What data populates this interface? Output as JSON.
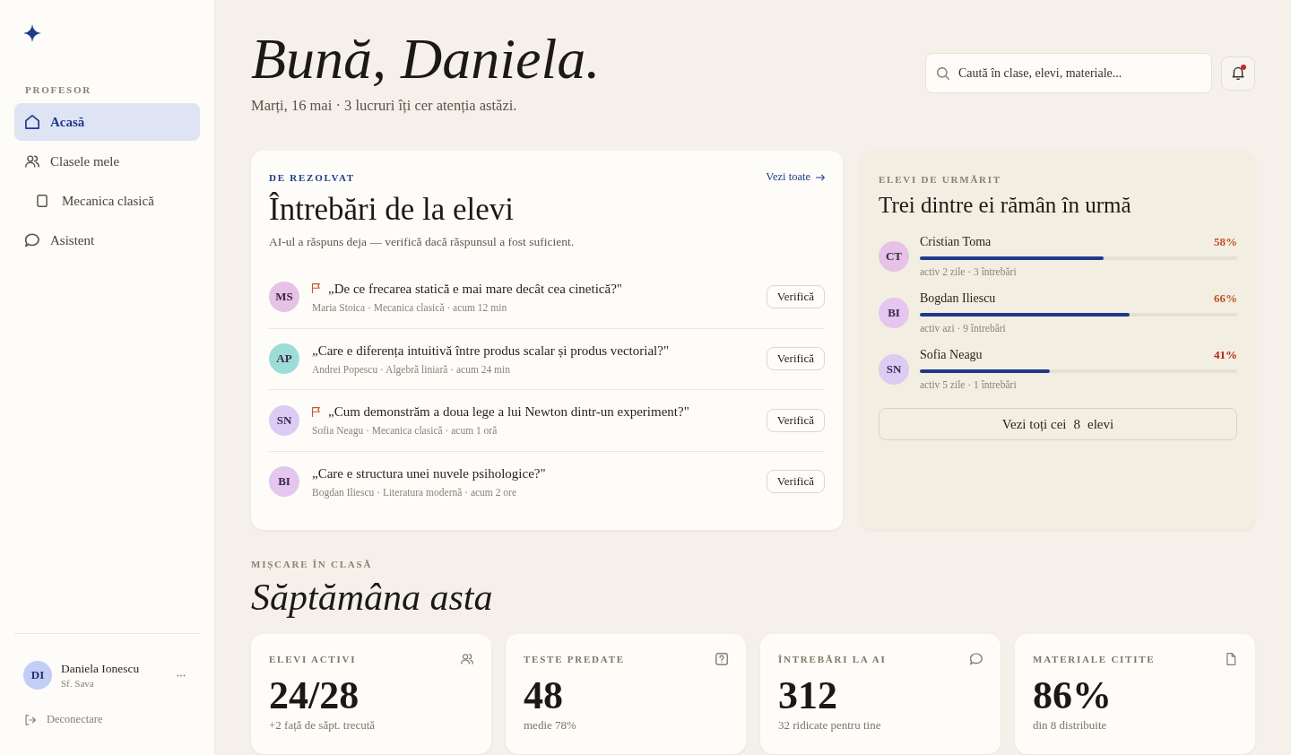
{
  "sidebar": {
    "section_label": "PROFESOR",
    "items": [
      {
        "label": "Acasă",
        "selected": true
      },
      {
        "label": "Clasele mele",
        "selected": false,
        "children": [
          {
            "label": "Mecanica clasică",
            "selected": false
          }
        ]
      },
      {
        "label": "Asistent",
        "selected": false
      }
    ],
    "user": {
      "initials": "DI",
      "color": "#c3cdf6",
      "name": "Daniela Ionescu",
      "school": "Sf. Sava"
    },
    "logout": "Deconectare"
  },
  "header": {
    "greeting": "Bună, Daniela.",
    "subtitle": "Marți, 16 mai · 3 lucruri îți cer atenția astăzi.",
    "search": {
      "placeholder": "Caută în clase, elevi, materiale..."
    },
    "notifications": {
      "unread": true
    }
  },
  "questions_card": {
    "eyebrow": "DE REZOLVAT",
    "link": "Vezi toate",
    "title": "Întrebări de la elevi",
    "subtitle": "AI-ul a răspuns deja — verifică dacă răspunsul a fost suficient.",
    "items": [
      {
        "avatar": {
          "initials": "MS",
          "color": "#e6c3e6"
        },
        "flagged": true,
        "question": "„De ce frecarea statică e mai mare decât cea cinetică?\"",
        "meta": "Maria Stoica · Mecanica clasică · acum 12 min",
        "action": "Verifică"
      },
      {
        "avatar": {
          "initials": "AP",
          "color": "#9edcd8"
        },
        "flagged": false,
        "question": "„Care e diferența intuitivă între produs scalar și produs vectorial?\"",
        "meta": "Andrei Popescu · Algebră liniară · acum 24 min",
        "action": "Verifică"
      },
      {
        "avatar": {
          "initials": "SN",
          "color": "#dccbf2"
        },
        "flagged": true,
        "question": "„Cum demonstrăm a doua lege a lui Newton dintr-un experiment?\"",
        "meta": "Sofia Neagu · Mecanica clasică · acum 1 oră",
        "action": "Verifică"
      },
      {
        "avatar": {
          "initials": "BI",
          "color": "#e4c6ee"
        },
        "flagged": false,
        "question": "„Care e structura unei nuvele psihologice?\"",
        "meta": "Bogdan Iliescu · Literatura modernă · acum 2 ore",
        "action": "Verifică"
      }
    ]
  },
  "students_card": {
    "eyebrow": "ELEVI DE URMĂRIT",
    "title": "Trei dintre ei rămân în urmă",
    "students": [
      {
        "avatar": {
          "initials": "CT",
          "color": "#e6c3e6"
        },
        "name": "Cristian Toma",
        "score": {
          "text": "58%",
          "color": "#c0532a"
        },
        "level": 0.58,
        "meta": "activ 2 zile · 3 întrebări"
      },
      {
        "avatar": {
          "initials": "BI",
          "color": "#e4c6ee"
        },
        "name": "Bogdan Iliescu",
        "score": {
          "text": "66%",
          "color": "#c0532a"
        },
        "level": 0.66,
        "meta": "activ azi · 9 întrebări"
      },
      {
        "avatar": {
          "initials": "SN",
          "color": "#dccbf2"
        },
        "name": "Sofia Neagu",
        "score": {
          "text": "41%",
          "color": "#b42318"
        },
        "level": 0.41,
        "meta": "activ 5 zile · 1 întrebări"
      }
    ],
    "button": {
      "text_before": "Vezi toți cei",
      "count": "8",
      "text_after": "elevi"
    }
  },
  "week": {
    "eyebrow": "MIȘCARE ÎN CLASĂ",
    "title": "Săptămâna asta",
    "stats": [
      {
        "label": "ELEVI ACTIVI",
        "value": "24/28",
        "note": "+2 față de săpt. trecută"
      },
      {
        "label": "TESTE PREDATE",
        "value": "48",
        "note": "medie 78%"
      },
      {
        "label": "ÎNTREBĂRI LA AI",
        "value": "312",
        "note": "32 ridicate pentru tine"
      },
      {
        "label": "MATERIALE CITITE",
        "value": "86%",
        "note": "din 8 distribuite"
      }
    ]
  }
}
